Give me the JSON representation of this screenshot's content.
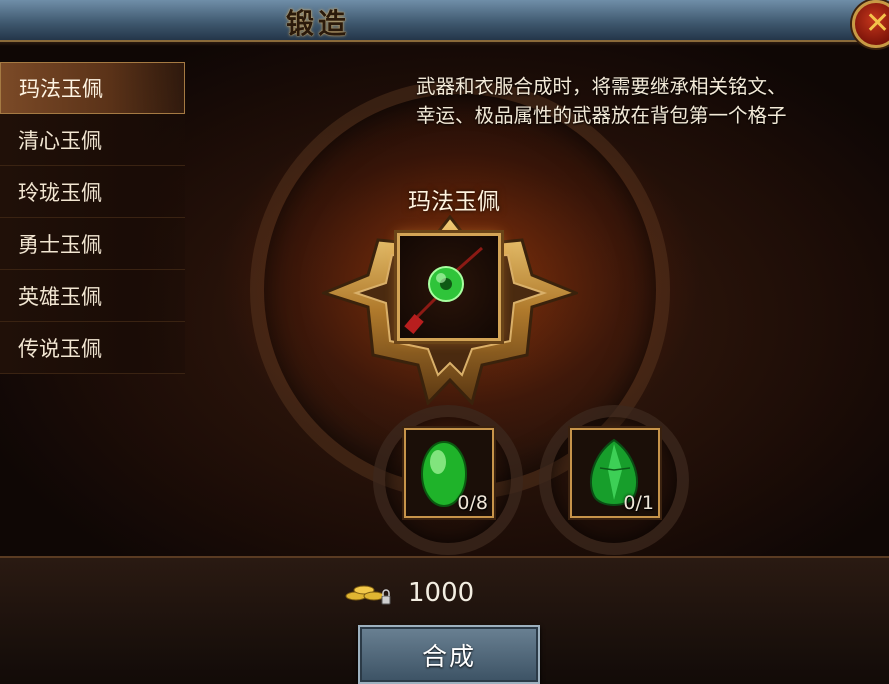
{
  "window": {
    "title": "锻造"
  },
  "close_button": {
    "icon": "close-x-icon"
  },
  "sidebar": {
    "items": [
      {
        "label": "玛法玉佩",
        "active": true
      },
      {
        "label": "清心玉佩",
        "active": false
      },
      {
        "label": "玲珑玉佩",
        "active": false
      },
      {
        "label": "勇士玉佩",
        "active": false
      },
      {
        "label": "英雄玉佩",
        "active": false
      },
      {
        "label": "传说玉佩",
        "active": false
      }
    ]
  },
  "hint": "武器和衣服合成时，将需要继承相关铭文、\n幸运、极品属性的武器放在背包第一个格子",
  "target_item": {
    "name": "玛法玉佩",
    "icon": "jade-pendant-icon"
  },
  "materials": [
    {
      "icon": "green-jade-stone-icon",
      "count": "0/8"
    },
    {
      "icon": "emerald-gem-icon",
      "count": "0/1"
    }
  ],
  "cost": {
    "icon": "gold-coins-icon",
    "amount": "1000"
  },
  "craft_button": {
    "label": "合成"
  },
  "colors": {
    "accent_gold": "#d3a456",
    "title_bar": "#4d6a82",
    "jade": "#2fc43a"
  }
}
